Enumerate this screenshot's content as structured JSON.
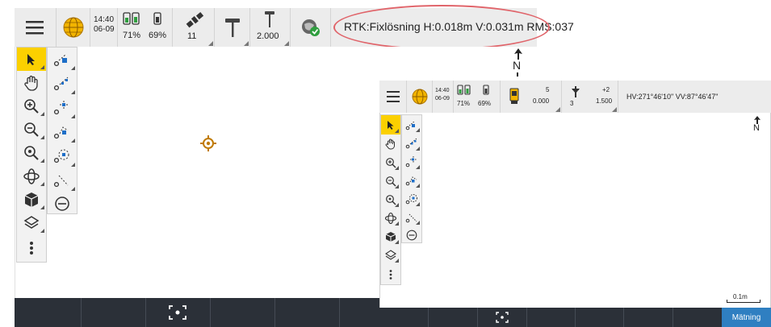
{
  "screenA": {
    "status": {
      "time": "14:40",
      "date": "06-09",
      "battery1": "71%",
      "battery2": "69%",
      "satellites": "11",
      "antenna_height": "2.000",
      "rtk_text": "RTK:Fixlösning H:0.018m V:0.031m RMS:037"
    },
    "north_label": "N"
  },
  "screenB": {
    "status": {
      "time": "14:40",
      "date": "06-09",
      "battery1": "71%",
      "battery2": "69%",
      "instrument_value": "5",
      "instrument_sub": "0.000",
      "target_value": "+2",
      "target_sub": "1.500",
      "target_num": "3",
      "angles": "HV:271°46'10\"  VV:87°46'47\""
    },
    "north_label": "N",
    "scale_label": "0.1m",
    "measure_button": "Mätning"
  },
  "colors": {
    "accent": "#fbd000",
    "bottom_bar": "#2b3038",
    "measure_button": "#2f7fc1",
    "highlight_ring": "#e0646a",
    "target_marker": "#c07a00"
  }
}
